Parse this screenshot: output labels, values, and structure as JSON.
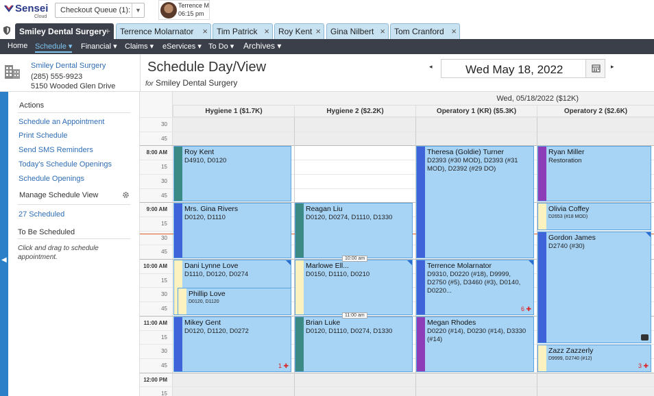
{
  "app": {
    "brand": "Sensei",
    "brand_sub": "Cloud",
    "queue": {
      "label": "Checkout Queue (1):"
    },
    "user": {
      "name": "Terrence M",
      "time": "06:15 pm"
    }
  },
  "tabs": [
    {
      "label": "Smiley Dental Surgery",
      "close": "+",
      "active": true
    },
    {
      "label": "Terrence Molarnator",
      "close": "×"
    },
    {
      "label": "Tim Patrick",
      "close": "×"
    },
    {
      "label": "Roy Kent",
      "close": "×"
    },
    {
      "label": "Gina Nilbert",
      "close": "×"
    },
    {
      "label": "Tom Cranford",
      "close": "×"
    }
  ],
  "nav": [
    {
      "label": "Home"
    },
    {
      "label": "Schedule ▾",
      "active": true
    },
    {
      "label": "Financial ▾"
    },
    {
      "label": "Claims ▾"
    },
    {
      "label": "eServices ▾"
    },
    {
      "label": "To Do ▾"
    },
    {
      "label": "Archives ▾"
    }
  ],
  "practice": {
    "name": "Smiley Dental Surgery",
    "phone": "(285) 555-9923",
    "address": "5150 Wooded Glen Drive"
  },
  "header": {
    "title": "Schedule Day/View",
    "for_label": "for",
    "for_value": "Smiley Dental Surgery",
    "date": "Wed May 18, 2022",
    "prev": "◂",
    "next": "▸"
  },
  "sidebar": {
    "actions_title": "Actions",
    "links": [
      "Schedule an Appointment",
      "Print Schedule",
      "Send SMS Reminders",
      "Today's Schedule Openings",
      "Schedule Openings"
    ],
    "manage_label": "Manage Schedule View",
    "scheduled_link": "27 Scheduled",
    "to_be_title": "To Be Scheduled",
    "hint": "Click and drag to schedule appointment."
  },
  "schedule": {
    "date_header": "Wed, 05/18/2022 ($12K)",
    "columns": [
      "Hygiene 1 ($1.7K)",
      "Hygiene 2 ($2.2K)",
      "Operatory 1 (KR) ($5.3K)",
      "Operatory 2 ($2.6K)"
    ],
    "time_labels": [
      "30",
      "45",
      "8:00 AM",
      "15",
      "30",
      "45",
      "9:00 AM",
      "15",
      "30",
      "45",
      "10:00 AM",
      "15",
      "30",
      "45",
      "11:00 AM",
      "15",
      "30",
      "45",
      "12:00 PM",
      "15"
    ],
    "appointments": [
      {
        "col": 0,
        "name": "Roy Kent",
        "codes": "D4910, D0120",
        "bar": "#3b8a86",
        "start": 2,
        "len": 4
      },
      {
        "col": 0,
        "name": "Mrs. Gina Rivers",
        "codes": "D0120, D1110",
        "bar": "#3f63d8",
        "start": 6,
        "len": 4
      },
      {
        "col": 0,
        "name": "Dani Lynne Love",
        "codes": "D1110, D0120, D0274",
        "bar": "#fbf2c0",
        "start": 10,
        "len": 4,
        "corner": true
      },
      {
        "col": 0,
        "name": "Phillip Love",
        "codes": "D0120, D1120",
        "bar": "#fbf2c0",
        "start": 12,
        "len": 2,
        "inset": true,
        "small": true
      },
      {
        "col": 0,
        "name": "Mikey Gent",
        "codes": "D0120, D1120, D0272",
        "bar": "#3f63d8",
        "start": 14,
        "len": 4,
        "badge": "1 ✚"
      },
      {
        "col": 1,
        "name": "Reagan Liu",
        "codes": "D0120, D0274, D1110, D1330",
        "bar": "#3b8a86",
        "start": 6,
        "len": 4
      },
      {
        "col": 1,
        "name": "Marlowe Ell...",
        "codes": "D0150, D1110, D0210",
        "bar": "#fbf2c0",
        "start": 10,
        "len": 4,
        "corner": true
      },
      {
        "col": 1,
        "name": "Brian Luke",
        "codes": "D0120, D1110, D0274, D1330",
        "bar": "#3b8a86",
        "start": 14,
        "len": 4
      },
      {
        "col": 2,
        "name": "Theresa (Goldie) Turner",
        "codes": "D2393 (#30 MOD), D2393 (#31 MOD), D2392 (#29 DO)",
        "bar": "#3f63d8",
        "start": 2,
        "len": 8
      },
      {
        "col": 2,
        "name": "Terrence Molarnator",
        "codes": "D9310, D0220 (#18), D9999, D2750 (#5), D3460 (#3), D0140, D0220...",
        "bar": "#3f63d8",
        "start": 10,
        "len": 4,
        "corner": true,
        "badge": "6 ✚"
      },
      {
        "col": 2,
        "name": "Megan Rhodes",
        "codes": "D0220 (#14), D0230 (#14), D3330 (#14)",
        "bar": "#8e3db8",
        "start": 14,
        "len": 4
      },
      {
        "col": 3,
        "name": "Ryan Miller",
        "codes": "Restoration",
        "bar": "#8e3db8",
        "start": 2,
        "len": 4
      },
      {
        "col": 3,
        "name": "Olivia Coffey",
        "codes": "D2653 (#18 MOD)",
        "bar": "#fbf2c0",
        "start": 6,
        "len": 2,
        "small": true
      },
      {
        "col": 3,
        "name": "Gordon James",
        "codes": "D2740 (#30)",
        "bar": "#3f63d8",
        "start": 8,
        "len": 8,
        "corner": true,
        "chat": true
      },
      {
        "col": 3,
        "name": "Zazz Zazzerly",
        "codes": "D9999, D2740 (#12)",
        "bar": "#fbf2c0",
        "start": 16,
        "len": 2,
        "small": true,
        "badge": "3 ✚"
      }
    ],
    "tooltips": [
      "10:00 am",
      "11:00 am"
    ]
  },
  "colors": {
    "nav_bg": "#3a3f4a",
    "accent": "#2b80c8",
    "appt_bg": "#a7d3f5",
    "now_line": "#e05a2a"
  },
  "icons": [
    "sensei-logo-icon",
    "chevron-down-icon",
    "shield-icon",
    "building-icon",
    "calendar-icon",
    "gear-icon",
    "chevron-left-icon",
    "chat-icon",
    "plus-icon"
  ]
}
